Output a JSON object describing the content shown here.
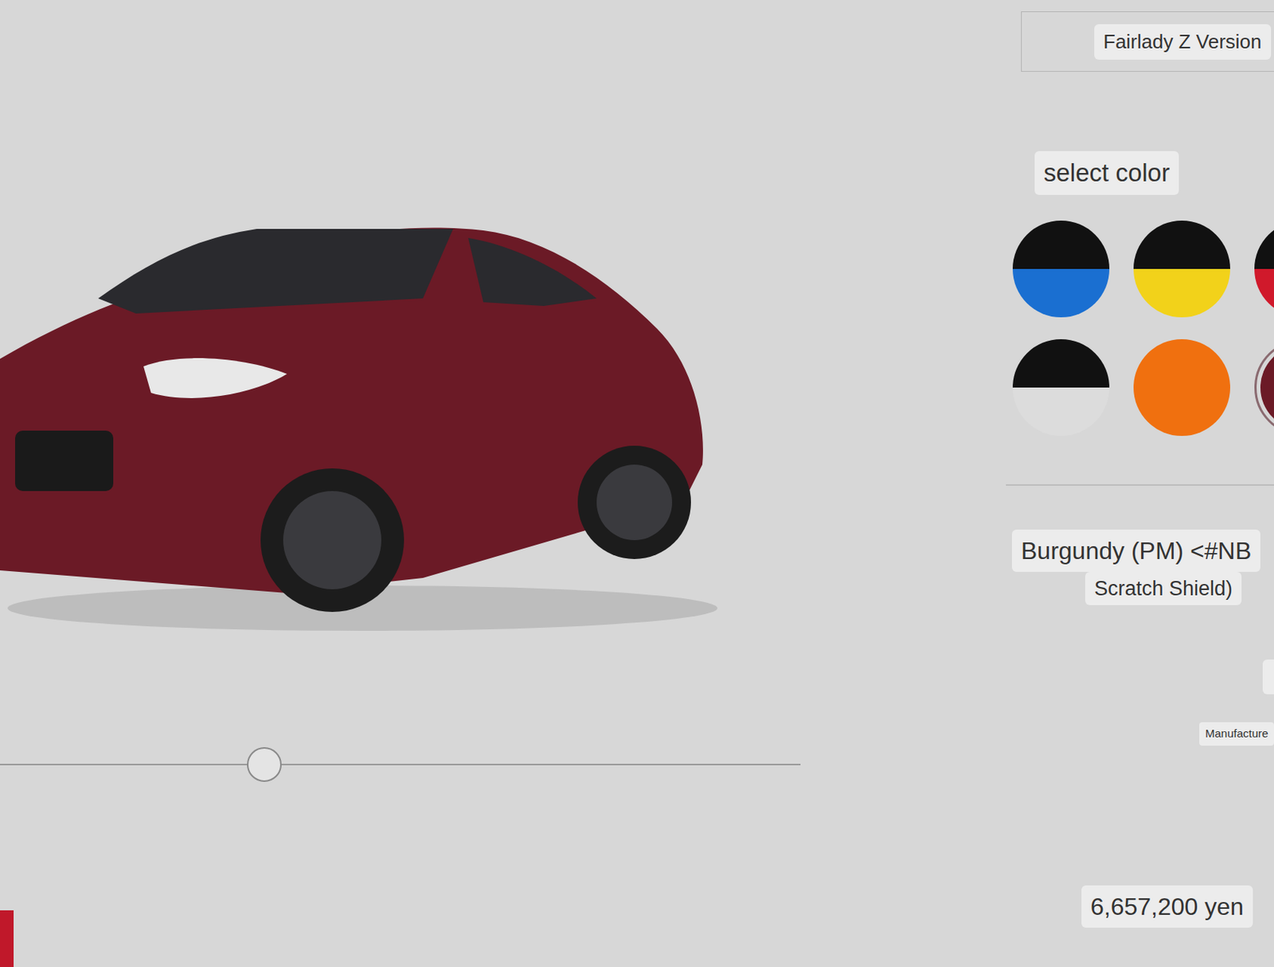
{
  "header": {
    "title": "Fairlady Z Version"
  },
  "color_picker": {
    "label": "select color",
    "swatches": [
      {
        "top": "#111111",
        "bottom": "#1a6fd1",
        "selected": false
      },
      {
        "top": "#111111",
        "bottom": "#f2d21a",
        "selected": false
      },
      {
        "top": "#111111",
        "bottom": "#d0192b",
        "selected": false
      },
      {
        "top": "#111111",
        "bottom": "#dcdcdc",
        "selected": false
      },
      {
        "top": "#f0700f",
        "bottom": "#f0700f",
        "selected": false
      },
      {
        "top": "#6b1a26",
        "bottom": "#6b1a26",
        "selected": true
      }
    ],
    "selected_name": "Burgundy (PM) <#NB",
    "selected_note": "Scratch Shield)"
  },
  "rotation_slider": {
    "level": 0.33
  },
  "footnote": "Manufacture",
  "price": "6,657,200 yen"
}
